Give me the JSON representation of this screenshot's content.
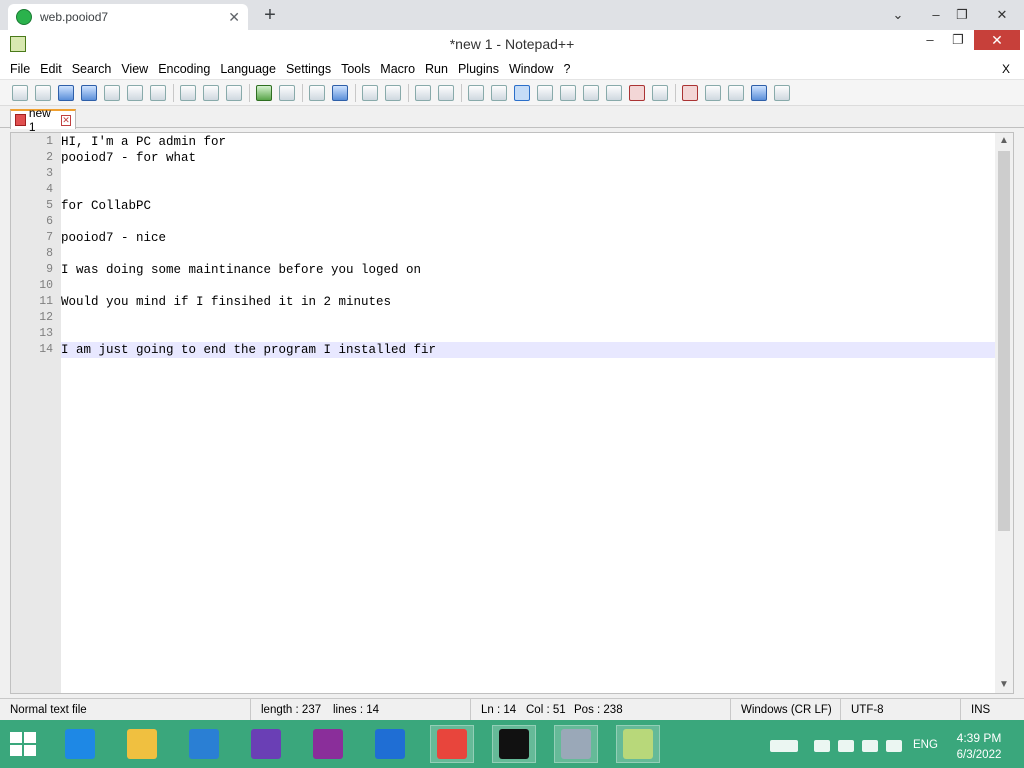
{
  "browser": {
    "tab_title": "web.pooiod7",
    "tab_close": "✕",
    "new_tab": "+",
    "window_buttons": [
      "⌄",
      "–",
      "❐",
      "✕"
    ]
  },
  "window": {
    "title": "*new 1 - Notepad++",
    "buttons": [
      "–",
      "❐",
      "✕"
    ]
  },
  "menu": {
    "items": [
      "File",
      "Edit",
      "Search",
      "View",
      "Encoding",
      "Language",
      "Settings",
      "Tools",
      "Macro",
      "Run",
      "Plugins",
      "Window",
      "?"
    ],
    "close": "X"
  },
  "tab": {
    "label": "new 1",
    "close": "✕"
  },
  "editor": {
    "line_numbers": [
      "1",
      "2",
      "3",
      "4",
      "5",
      "6",
      "7",
      "8",
      "9",
      "10",
      "11",
      "12",
      "13",
      "14"
    ],
    "lines": [
      "HI, I'm a PC admin for",
      "pooiod7 - for what",
      "",
      "",
      "for CollabPC",
      "",
      "pooiod7 - nice",
      "",
      "I was doing some maintinance before you loged on",
      "",
      "Would you mind if I finsihed it in 2 minutes",
      "",
      "",
      "I am just going to end the program I installed fir"
    ],
    "current_line_index": 13,
    "scroll_up": "▲",
    "scroll_down": "▼"
  },
  "status": {
    "file_type": "Normal text file",
    "length": "length : 237",
    "lines": "lines : 14",
    "ln": "Ln : 14",
    "col": "Col : 51",
    "pos": "Pos : 238",
    "eol": "Windows (CR LF)",
    "encoding": "UTF-8",
    "mode": "INS"
  },
  "taskbar": {
    "apps": [
      {
        "icon": "internet-explorer-icon",
        "color": "#1e88e5"
      },
      {
        "icon": "file-explorer-icon",
        "color": "#f0c040"
      },
      {
        "icon": "weather-icon",
        "color": "#2a7fd4"
      },
      {
        "icon": "settings-icon",
        "color": "#6a3fb5"
      },
      {
        "icon": "onenote-icon",
        "color": "#8a2e9a"
      },
      {
        "icon": "onedrive-icon",
        "color": "#1f6ed4"
      },
      {
        "icon": "chrome-icon",
        "color": "#e8453c"
      },
      {
        "icon": "command-prompt-icon",
        "color": "#111111"
      },
      {
        "icon": "disk-utility-icon",
        "color": "#9aa8b8"
      },
      {
        "icon": "notepadpp-icon",
        "color": "#b8d87a"
      }
    ],
    "language": "ENG",
    "time": "4:39 PM",
    "date": "6/3/2022"
  }
}
